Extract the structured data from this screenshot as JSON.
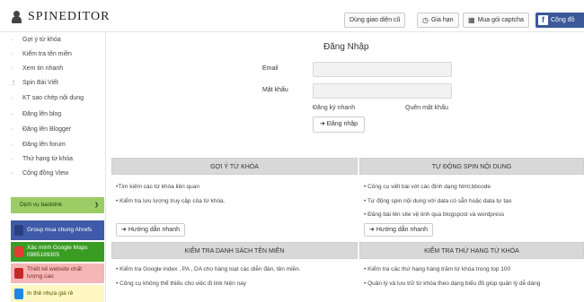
{
  "header": {
    "logo_text": "SPINEDITOR",
    "btn_old_ui": "Dùng giao diện cũ",
    "btn_extend": "Gia hạn",
    "btn_captcha": "Mua gói captcha",
    "btn_community": "Cộng đồ"
  },
  "sidebar": {
    "items": [
      {
        "label": "Gợi ý từ khóa"
      },
      {
        "label": "Kiểm tra tên miền"
      },
      {
        "label": "Xem tin nhanh"
      },
      {
        "label": "Spin Bài Viết"
      },
      {
        "label": "KT sao chép nội dung"
      },
      {
        "label": "Đăng lên blog"
      },
      {
        "label": "Đăng lên Blogger"
      },
      {
        "label": "Đăng lên forum"
      },
      {
        "label": "Thứ hạng từ khóa"
      },
      {
        "label": "Cộng đồng View"
      }
    ],
    "ads": {
      "backlink": "Dịch vụ backlink",
      "group": "Group mua chung Ahrefs",
      "maps_line1": "Xác minh Google Maps",
      "maps_line2": "0985189305",
      "web_line1": "Thiết kế website chất",
      "web_line2": "lượng cao",
      "print": "In thẻ nhựa giá rẻ"
    }
  },
  "login": {
    "title": "Đăng Nhập",
    "email_label": "Email",
    "email_value": "",
    "password_label": "Mật khẩu",
    "password_value": "",
    "register_link": "Đăng ký nhanh",
    "forgot_link": "Quên mật khẩu",
    "submit_label": "Đăng nhập"
  },
  "panels": {
    "keyword": {
      "title": "GỢI Ý TỪ KHÓA",
      "bullets": [
        "•Tìm kiếm các từ khóa liên quan",
        "• Kiểm tra lưu lượng truy cập của từ khóa."
      ],
      "guide": "Hướng dẫn nhanh"
    },
    "spin": {
      "title": "TỰ ĐỘNG SPIN NỘI DUNG",
      "bullets": [
        "• Công cụ viết bài với các định dạng html,bbcode",
        "• Tự động spin nội dung với data có sẵn hoặc data tự tạo",
        "• Đăng bài lên site vệ tinh qua blogspost và wordpress"
      ],
      "guide": "Hướng dẫn nhanh"
    },
    "domain": {
      "title": "KIỂM TRA DANH SÁCH TÊN MIỀN",
      "bullets": [
        "• Kiểm tra Google index , PA , DA cho hàng loạt các diễn đàn, tên miền.",
        "• Công cụ không thể thiếu cho việc đi link hiện nay"
      ]
    },
    "rank": {
      "title": "KIỂM TRA THỨ HẠNG TỪ KHÓA",
      "bullets": [
        "• Kiểm tra các thứ hạng hàng trăm từ khóa trong top 100",
        "• Quản lý và lưu trữ từ khóa theo dạng biểu đồ giúp quản lý dễ dàng"
      ]
    }
  },
  "colors": {
    "facebook": "#3b5998",
    "backlink_ad": "#9ccc65",
    "group_ad": "#3f5aa8",
    "maps_ad": "#3a9d23",
    "web_ad": "#f4b6b6",
    "print_ad": "#fff7c2",
    "panel_header": "#d8d8d8"
  }
}
